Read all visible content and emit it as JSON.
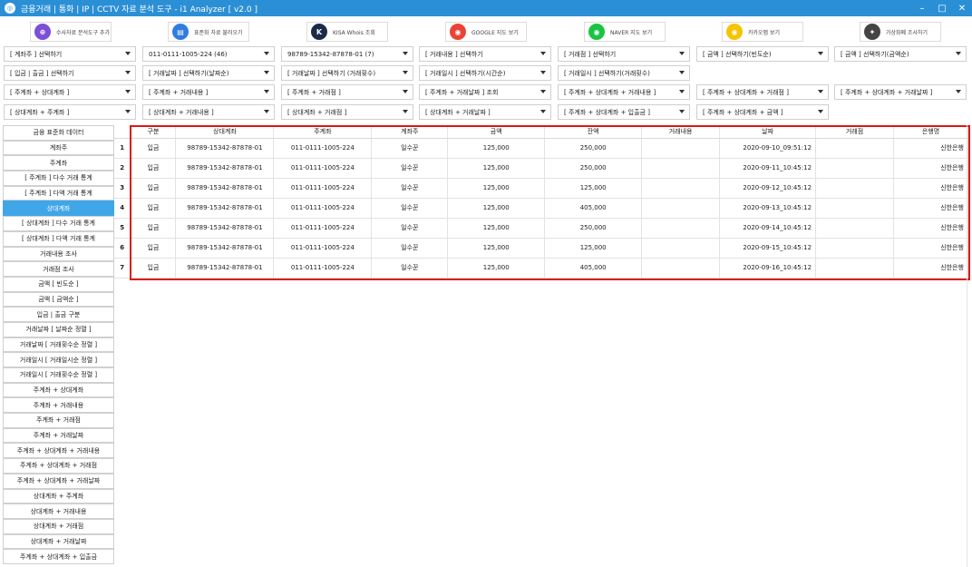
{
  "window": {
    "title": "금융거래 | 통화 | IP | CCTV 자료 분석 도구 - i1 Analyzer [ v2.0 ]",
    "minimize": "–",
    "maximize": "□",
    "close": "✕"
  },
  "toolbar": [
    {
      "label": "수사자료 분석도구 추가",
      "icon": "analysis-add-icon",
      "color": "#7b4fd6"
    },
    {
      "label": "표준화 자료 불러오기",
      "icon": "document-icon",
      "color": "#2f7de0"
    },
    {
      "label": "KISA Whois 조회",
      "icon": "kisa-logo-icon",
      "color": "#1c2a4a"
    },
    {
      "label": "GOOGLE 지도 보기",
      "icon": "google-maps-icon",
      "color": "#ea4335"
    },
    {
      "label": "NAVER 지도 보기",
      "icon": "naver-map-icon",
      "color": "#19c442"
    },
    {
      "label": "카카오맵 보기",
      "icon": "kakao-map-icon",
      "color": "#f6c400"
    },
    {
      "label": "가상화폐 조사하기",
      "icon": "crypto-icon",
      "color": "#444444"
    }
  ],
  "filters": {
    "row1": [
      "[ 계좌주 ] 선택하기",
      "011-0111-1005-224 (46)",
      "98789-15342-87878-01 (7)",
      "[ 거래내용 ] 선택하기",
      "[ 거래점 ] 선택하기",
      "[ 금액 ] 선택하기(빈도순)",
      "[ 금액 ] 선택하기(금액순)"
    ],
    "row2": [
      "[ 입금 | 출금 ] 선택하기",
      "[ 거래날짜 ] 선택하기(날짜순)",
      "[ 거래날짜 ] 선택하기 (거래횟수)",
      "[ 거래일시 ] 선택하기(시간순)",
      "[ 거래일시 ] 선택하기(거래횟수)"
    ],
    "row3": [
      "[ 주계좌 + 상대계좌 ]",
      "[ 주계좌 + 거래내용 ]",
      "[ 주계좌 + 거래점 ]",
      "[ 주계좌 + 거래날짜 ] 조회",
      "[ 주계좌 + 상대계좌 + 거래내용 ]",
      "[ 주계좌 + 상대계좌 + 거래점 ]",
      "[ 주계좌 + 상대계좌 + 거래날짜 ]"
    ],
    "row4": [
      "[ 상대계좌 + 주계좌 ]",
      "[ 상대계좌 + 거래내용 ]",
      "[ 상대계좌 + 거래점 ]",
      "[ 상대계좌 + 거래날짜 ]",
      "[ 주계좌 + 상대계좌 + 입출금 ]",
      "[ 주계좌 + 상대계좌 + 금액 ]"
    ]
  },
  "sidebar": [
    "금융 표준화 데이터",
    "계좌주",
    "주계좌",
    "[ 주계좌 ] 다수 거래 통계",
    "[ 주계좌 ] 다액 거래 통계",
    "상대계좌",
    "[ 상대계좌 ] 다수 거래 통계",
    "[ 상대계좌 ] 다액 거래 통계",
    "거래내용 조사",
    "거래점 조사",
    "금액 [ 빈도순 ]",
    "금액 [ 금액순 ]",
    "입금 | 출금 구분",
    "거래날짜 [ 날짜순 정렬 ]",
    "거래날짜 [ 거래횟수순 정렬 ]",
    "거래일시 [ 거래일시순 정렬 ]",
    "거래일시 [ 거래횟수순 정렬 ]",
    "주계좌 + 상대계좌",
    "주계좌 + 거래내용",
    "주계좌 + 거래점",
    "주계좌 + 거래날짜",
    "주계좌 + 상대계좌 + 거래내용",
    "주계좌 + 상대계좌 + 거래점",
    "주계좌 + 상대계좌 + 거래날짜",
    "상대계좌 + 주계좌",
    "상대계좌 + 거래내용",
    "상대계좌 + 거래점",
    "상대계좌 + 거래날짜",
    "주계좌 + 상대계좌 + 입출금"
  ],
  "sidebar_active": "상대계좌",
  "table": {
    "columns": [
      "구분",
      "상대계좌",
      "주계좌",
      "계좌주",
      "금액",
      "잔액",
      "거래내용",
      "날짜",
      "거래점",
      "은행명"
    ],
    "rows": [
      {
        "n": "1",
        "c": [
          "입금",
          "98789-15342-87878-01",
          "011-0111-1005-224",
          "일수꾼",
          "125,000",
          "250,000",
          "",
          "2020-09-10_09:51:12",
          "",
          "신한은행"
        ]
      },
      {
        "n": "2",
        "c": [
          "입금",
          "98789-15342-87878-01",
          "011-0111-1005-224",
          "일수꾼",
          "125,000",
          "250,000",
          "",
          "2020-09-11_10:45:12",
          "",
          "신한은행"
        ]
      },
      {
        "n": "3",
        "c": [
          "입금",
          "98789-15342-87878-01",
          "011-0111-1005-224",
          "일수꾼",
          "125,000",
          "125,000",
          "",
          "2020-09-12_10:45:12",
          "",
          "신한은행"
        ]
      },
      {
        "n": "4",
        "c": [
          "입금",
          "98789-15342-87878-01",
          "011-0111-1005-224",
          "일수꾼",
          "125,000",
          "405,000",
          "",
          "2020-09-13_10:45:12",
          "",
          "신한은행"
        ]
      },
      {
        "n": "5",
        "c": [
          "입금",
          "98789-15342-87878-01",
          "011-0111-1005-224",
          "일수꾼",
          "125,000",
          "250,000",
          "",
          "2020-09-14_10:45:12",
          "",
          "신한은행"
        ]
      },
      {
        "n": "6",
        "c": [
          "입금",
          "98789-15342-87878-01",
          "011-0111-1005-224",
          "일수꾼",
          "125,000",
          "125,000",
          "",
          "2020-09-15_10:45:12",
          "",
          "신한은행"
        ]
      },
      {
        "n": "7",
        "c": [
          "입금",
          "98789-15342-87878-01",
          "011-0111-1005-224",
          "일수꾼",
          "125,000",
          "405,000",
          "",
          "2020-09-16_10:45:12",
          "",
          "신한은행"
        ]
      }
    ]
  },
  "colors": {
    "accent": "#3fa6e8",
    "titlebar": "#2b8fd6",
    "highlight": "#e01616"
  }
}
